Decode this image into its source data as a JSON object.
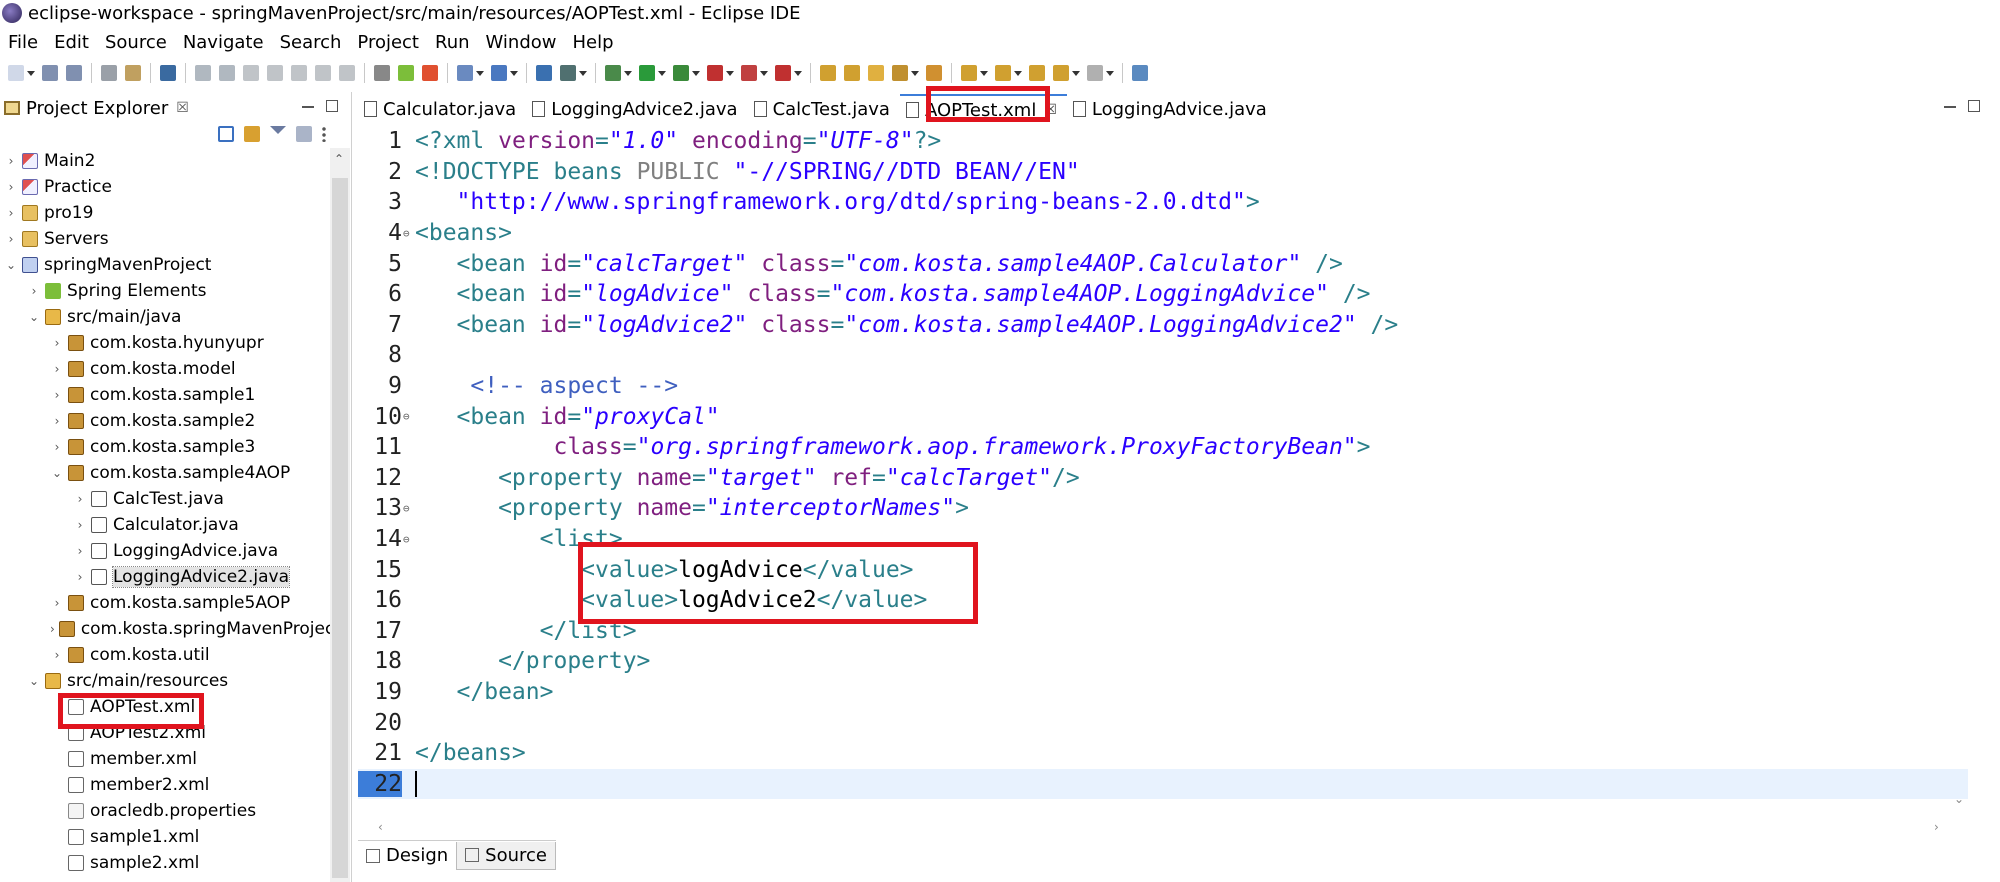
{
  "window": {
    "title": "eclipse-workspace - springMavenProject/src/main/resources/AOPTest.xml - Eclipse IDE"
  },
  "menu": [
    "File",
    "Edit",
    "Source",
    "Navigate",
    "Search",
    "Project",
    "Run",
    "Window",
    "Help"
  ],
  "explorer": {
    "title": "Project Explorer",
    "close_glyph": "☒",
    "tree": [
      {
        "label": "Main2",
        "depth": 0,
        "expander": "›",
        "icon": "project-icon"
      },
      {
        "label": "Practice",
        "depth": 0,
        "expander": "›",
        "icon": "project-icon"
      },
      {
        "label": "pro19",
        "depth": 0,
        "expander": "›",
        "icon": "folder-icon"
      },
      {
        "label": "Servers",
        "depth": 0,
        "expander": "›",
        "icon": "folder-icon"
      },
      {
        "label": "springMavenProject",
        "depth": 0,
        "expander": "⌄",
        "icon": "maven-project-icon"
      },
      {
        "label": "Spring Elements",
        "depth": 1,
        "expander": "›",
        "icon": "spring-icon"
      },
      {
        "label": "src/main/java",
        "depth": 1,
        "expander": "⌄",
        "icon": "source-folder-icon"
      },
      {
        "label": "com.kosta.hyunyupr",
        "depth": 2,
        "expander": "›",
        "icon": "package-icon"
      },
      {
        "label": "com.kosta.model",
        "depth": 2,
        "expander": "›",
        "icon": "package-icon"
      },
      {
        "label": "com.kosta.sample1",
        "depth": 2,
        "expander": "›",
        "icon": "package-icon"
      },
      {
        "label": "com.kosta.sample2",
        "depth": 2,
        "expander": "›",
        "icon": "package-icon"
      },
      {
        "label": "com.kosta.sample3",
        "depth": 2,
        "expander": "›",
        "icon": "package-icon"
      },
      {
        "label": "com.kosta.sample4AOP",
        "depth": 2,
        "expander": "⌄",
        "icon": "package-icon"
      },
      {
        "label": "CalcTest.java",
        "depth": 3,
        "expander": "›",
        "icon": "java-file-icon"
      },
      {
        "label": "Calculator.java",
        "depth": 3,
        "expander": "›",
        "icon": "java-file-icon"
      },
      {
        "label": "LoggingAdvice.java",
        "depth": 3,
        "expander": "›",
        "icon": "java-file-icon"
      },
      {
        "label": "LoggingAdvice2.java",
        "depth": 3,
        "expander": "›",
        "icon": "java-file-icon",
        "selected": true
      },
      {
        "label": "com.kosta.sample5AOP",
        "depth": 2,
        "expander": "›",
        "icon": "package-icon"
      },
      {
        "label": "com.kosta.springMavenProject",
        "depth": 2,
        "expander": "›",
        "icon": "package-icon"
      },
      {
        "label": "com.kosta.util",
        "depth": 2,
        "expander": "›",
        "icon": "package-icon"
      },
      {
        "label": "src/main/resources",
        "depth": 1,
        "expander": "⌄",
        "icon": "source-folder-icon"
      },
      {
        "label": "AOPTest.xml",
        "depth": 2,
        "expander": "",
        "icon": "xml-file-icon"
      },
      {
        "label": "AOPTest2.xml",
        "depth": 2,
        "expander": "",
        "icon": "xml-file-icon"
      },
      {
        "label": "member.xml",
        "depth": 2,
        "expander": "",
        "icon": "xml-file-icon"
      },
      {
        "label": "member2.xml",
        "depth": 2,
        "expander": "",
        "icon": "xml-file-icon"
      },
      {
        "label": "oracledb.properties",
        "depth": 2,
        "expander": "",
        "icon": "properties-file-icon"
      },
      {
        "label": "sample1.xml",
        "depth": 2,
        "expander": "",
        "icon": "xml-file-icon"
      },
      {
        "label": "sample2.xml",
        "depth": 2,
        "expander": "",
        "icon": "xml-file-icon"
      }
    ]
  },
  "editor": {
    "tabs": [
      {
        "label": "Calculator.java",
        "active": false
      },
      {
        "label": "LoggingAdvice2.java",
        "active": false
      },
      {
        "label": "CalcTest.java",
        "active": false
      },
      {
        "label": "AOPTest.xml",
        "active": true
      },
      {
        "label": "LoggingAdvice.java",
        "active": false
      }
    ],
    "tab_close_glyph": "☒",
    "current_line": 22,
    "lines": [
      {
        "n": "1",
        "fold": "",
        "tokens": [
          [
            "tag",
            "<?xml "
          ],
          [
            "attr",
            "version"
          ],
          [
            "tag",
            "="
          ],
          [
            "val",
            "\"1.0\""
          ],
          [
            "tag",
            " "
          ],
          [
            "attr",
            "encoding"
          ],
          [
            "tag",
            "="
          ],
          [
            "val",
            "\"UTF-8\""
          ],
          [
            "tag",
            "?>"
          ]
        ]
      },
      {
        "n": "2",
        "fold": "",
        "tokens": [
          [
            "tag",
            "<!DOCTYPE beans "
          ],
          [
            "kw",
            "PUBLIC "
          ],
          [
            "str",
            "\"-//SPRING//DTD BEAN//EN\""
          ]
        ]
      },
      {
        "n": "3",
        "fold": "",
        "tokens": [
          [
            "str",
            "   \"http://www.springframework.org/dtd/spring-beans-2.0.dtd\""
          ],
          [
            "tag",
            ">"
          ]
        ]
      },
      {
        "n": "4",
        "fold": "⊖",
        "tokens": [
          [
            "tag",
            "<beans>"
          ]
        ]
      },
      {
        "n": "5",
        "fold": "",
        "tokens": [
          [
            "tag",
            "   <bean "
          ],
          [
            "attr",
            "id"
          ],
          [
            "tag",
            "="
          ],
          [
            "val",
            "\"calcTarget\""
          ],
          [
            "tag",
            " "
          ],
          [
            "attr",
            "class"
          ],
          [
            "tag",
            "="
          ],
          [
            "val",
            "\"com.kosta.sample4AOP.Calculator\""
          ],
          [
            "tag",
            " />"
          ]
        ]
      },
      {
        "n": "6",
        "fold": "",
        "tokens": [
          [
            "tag",
            "   <bean "
          ],
          [
            "attr",
            "id"
          ],
          [
            "tag",
            "="
          ],
          [
            "val",
            "\"logAdvice\""
          ],
          [
            "tag",
            " "
          ],
          [
            "attr",
            "class"
          ],
          [
            "tag",
            "="
          ],
          [
            "val",
            "\"com.kosta.sample4AOP.LoggingAdvice\""
          ],
          [
            "tag",
            " />"
          ]
        ]
      },
      {
        "n": "7",
        "fold": "",
        "tokens": [
          [
            "tag",
            "   <bean "
          ],
          [
            "attr",
            "id"
          ],
          [
            "tag",
            "="
          ],
          [
            "val",
            "\"logAdvice2\""
          ],
          [
            "tag",
            " "
          ],
          [
            "attr",
            "class"
          ],
          [
            "tag",
            "="
          ],
          [
            "val",
            "\"com.kosta.sample4AOP.LoggingAdvice2\""
          ],
          [
            "tag",
            " />"
          ]
        ]
      },
      {
        "n": "8",
        "fold": "",
        "tokens": []
      },
      {
        "n": "9",
        "fold": "",
        "tokens": [
          [
            "comment",
            "    <!-- aspect -->"
          ]
        ]
      },
      {
        "n": "10",
        "fold": "⊖",
        "tokens": [
          [
            "tag",
            "   <bean "
          ],
          [
            "attr",
            "id"
          ],
          [
            "tag",
            "="
          ],
          [
            "val",
            "\"proxyCal\""
          ]
        ]
      },
      {
        "n": "11",
        "fold": "",
        "tokens": [
          [
            "tag",
            "          "
          ],
          [
            "attr",
            "class"
          ],
          [
            "tag",
            "="
          ],
          [
            "val",
            "\"org.springframework.aop.framework.ProxyFactoryBean\""
          ],
          [
            "tag",
            ">"
          ]
        ]
      },
      {
        "n": "12",
        "fold": "",
        "tokens": [
          [
            "tag",
            "      <property "
          ],
          [
            "attr",
            "name"
          ],
          [
            "tag",
            "="
          ],
          [
            "val",
            "\"target\""
          ],
          [
            "tag",
            " "
          ],
          [
            "attr",
            "ref"
          ],
          [
            "tag",
            "="
          ],
          [
            "val",
            "\"calcTarget\""
          ],
          [
            "tag",
            "/>"
          ]
        ]
      },
      {
        "n": "13",
        "fold": "⊖",
        "tokens": [
          [
            "tag",
            "      <property "
          ],
          [
            "attr",
            "name"
          ],
          [
            "tag",
            "="
          ],
          [
            "val",
            "\"interceptorNames\""
          ],
          [
            "tag",
            ">"
          ]
        ]
      },
      {
        "n": "14",
        "fold": "⊖",
        "tokens": [
          [
            "tag",
            "         <list>"
          ]
        ]
      },
      {
        "n": "15",
        "fold": "",
        "tokens": [
          [
            "tag",
            "            <value>"
          ],
          [
            "text",
            "logAdvice"
          ],
          [
            "tag",
            "</value>"
          ]
        ]
      },
      {
        "n": "16",
        "fold": "",
        "tokens": [
          [
            "tag",
            "            <value>"
          ],
          [
            "text",
            "logAdvice2"
          ],
          [
            "tag",
            "</value>"
          ]
        ]
      },
      {
        "n": "17",
        "fold": "",
        "tokens": [
          [
            "tag",
            "         </list>"
          ]
        ]
      },
      {
        "n": "18",
        "fold": "",
        "tokens": [
          [
            "tag",
            "      </property>"
          ]
        ]
      },
      {
        "n": "19",
        "fold": "",
        "tokens": [
          [
            "tag",
            "   </bean>"
          ]
        ]
      },
      {
        "n": "20",
        "fold": "",
        "tokens": []
      },
      {
        "n": "21",
        "fold": "",
        "tokens": [
          [
            "tag",
            "</beans>"
          ]
        ]
      },
      {
        "n": "22",
        "fold": "",
        "tokens": []
      }
    ],
    "bottom_tabs": [
      {
        "label": "Design",
        "active": false
      },
      {
        "label": "Source",
        "active": true
      }
    ]
  },
  "colors": {
    "tag": "#2a7f8a",
    "attr": "#7f1f7f",
    "value": "#2a00ff",
    "comment": "#3f5fbf",
    "highlight_box": "#e0141e",
    "current_line_bg": "#e8f2fe"
  }
}
